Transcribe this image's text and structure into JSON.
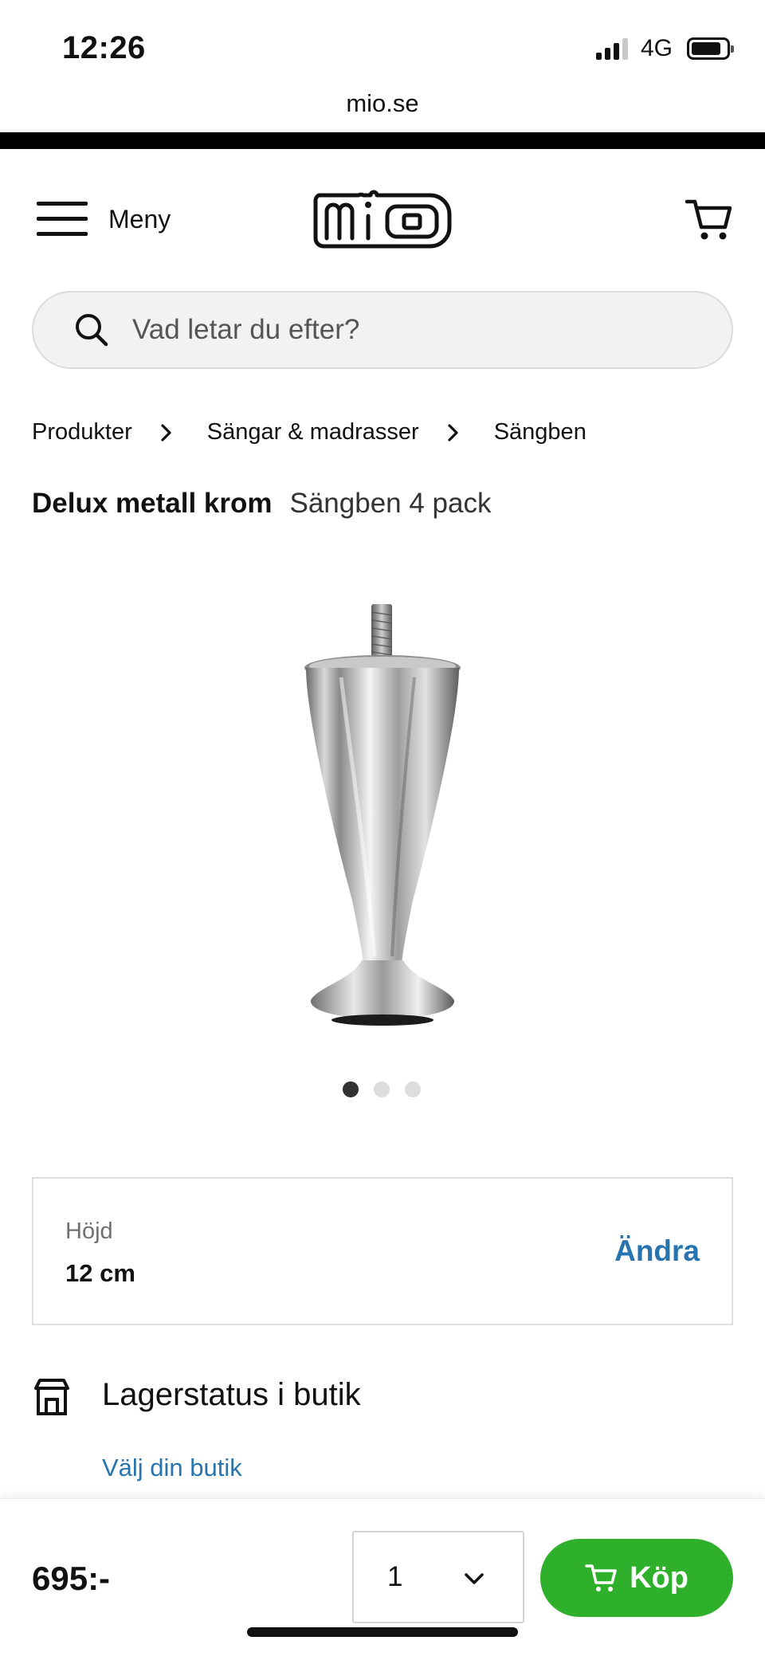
{
  "status_bar": {
    "time": "12:26",
    "network": "4G"
  },
  "browser": {
    "url": "mio.se"
  },
  "header": {
    "menu_label": "Meny",
    "logo_text": "mio",
    "cart_icon": "cart-icon",
    "menu_icon": "hamburger-icon"
  },
  "search": {
    "placeholder": "Vad letar du efter?",
    "icon": "search-icon"
  },
  "breadcrumb": {
    "items": [
      {
        "label": "Produkter"
      },
      {
        "label": "Sängar & madrasser"
      },
      {
        "label": "Sängben"
      }
    ]
  },
  "product": {
    "name": "Delux metall krom",
    "subtitle": "Sängben 4 pack",
    "image_count": 3,
    "active_image": 1
  },
  "variant": {
    "label": "Höjd",
    "value": "12 cm",
    "change_label": "Ändra"
  },
  "stock": {
    "title": "Lagerstatus i butik",
    "link": "Välj din butik",
    "icon": "store-icon"
  },
  "purchase": {
    "price": "695:-",
    "quantity": "1",
    "buy_label": "Köp"
  },
  "colors": {
    "accent_blue": "#2774ae",
    "buy_green": "#2fb02c"
  }
}
